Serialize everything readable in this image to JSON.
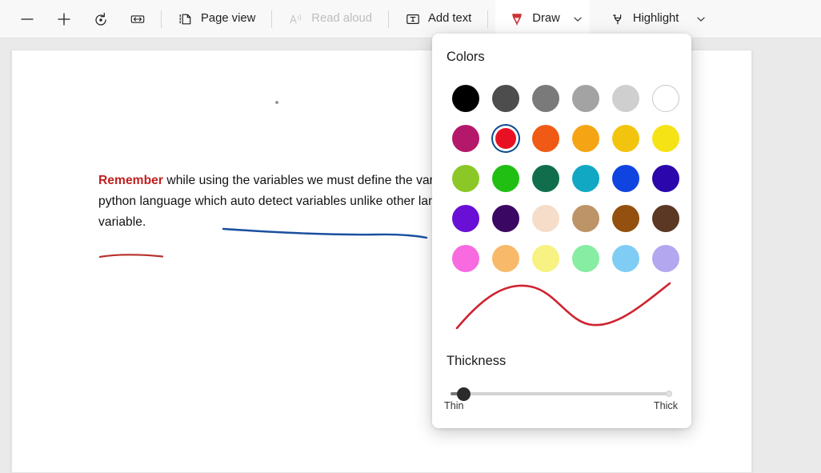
{
  "toolbar": {
    "items": [
      {
        "name": "zoom-out",
        "icon": "minus-icon",
        "label": "",
        "disabled": false
      },
      {
        "name": "zoom-in",
        "icon": "plus-icon",
        "label": "",
        "disabled": false
      },
      {
        "name": "rotate",
        "icon": "rotate-icon",
        "label": "",
        "disabled": false
      },
      {
        "name": "fit-width",
        "icon": "fit-width-icon",
        "label": "",
        "disabled": false
      },
      {
        "name": "page-view",
        "icon": "page-view-icon",
        "label": "Page view",
        "disabled": false
      },
      {
        "name": "read-aloud",
        "icon": "read-aloud-icon",
        "label": "Read aloud",
        "disabled": true
      },
      {
        "name": "add-text",
        "icon": "add-text-icon",
        "label": "Add text",
        "disabled": false
      }
    ],
    "draw": {
      "label": "Draw",
      "icon": "draw-pen-icon",
      "active": true,
      "accent_color": "#1565c0"
    },
    "highlight": {
      "label": "Highlight",
      "icon": "highlighter-icon",
      "active": false
    }
  },
  "document": {
    "paragraph_lead": "Remember",
    "paragraph_body": " while using the variables we must define the variable of integer type in above example. It is python language which auto detect variables unlike other languages which require to declare type of variable.",
    "ink_strokes": [
      {
        "name": "blue-underline-stroke",
        "color": "#1a4fa0"
      },
      {
        "name": "red-underline-stroke",
        "color": "#b7302c"
      }
    ],
    "ink_dot": {
      "name": "ink-dot",
      "color": "#9a9a9a"
    }
  },
  "colors_panel": {
    "title": "Colors",
    "selected_color": "#e81123",
    "selected_index": 7,
    "swatches": [
      {
        "name": "black",
        "hex": "#000000"
      },
      {
        "name": "dark-gray",
        "hex": "#4d4d4d"
      },
      {
        "name": "gray",
        "hex": "#7a7a7a"
      },
      {
        "name": "medium-gray",
        "hex": "#a3a3a3"
      },
      {
        "name": "light-gray",
        "hex": "#cfcfcf"
      },
      {
        "name": "white",
        "hex": "#ffffff"
      },
      {
        "name": "magenta",
        "hex": "#b4186a"
      },
      {
        "name": "red",
        "hex": "#e81123"
      },
      {
        "name": "orange-red",
        "hex": "#f05a14"
      },
      {
        "name": "orange",
        "hex": "#f5a414"
      },
      {
        "name": "gold",
        "hex": "#f2c40d"
      },
      {
        "name": "yellow",
        "hex": "#f5e315"
      },
      {
        "name": "yellow-green",
        "hex": "#8bc827"
      },
      {
        "name": "green",
        "hex": "#21bf14"
      },
      {
        "name": "dark-green",
        "hex": "#116e4c"
      },
      {
        "name": "teal",
        "hex": "#11a8c4"
      },
      {
        "name": "blue",
        "hex": "#1044e0"
      },
      {
        "name": "dark-blue",
        "hex": "#2b06ac"
      },
      {
        "name": "violet",
        "hex": "#6a0fd6"
      },
      {
        "name": "dark-purple",
        "hex": "#3a0863"
      },
      {
        "name": "peach",
        "hex": "#f6ddc9"
      },
      {
        "name": "tan",
        "hex": "#bd9467"
      },
      {
        "name": "brown",
        "hex": "#93500f"
      },
      {
        "name": "dark-brown",
        "hex": "#5a3824"
      },
      {
        "name": "pink",
        "hex": "#f86ae0"
      },
      {
        "name": "light-orange",
        "hex": "#f8b96b"
      },
      {
        "name": "light-yellow",
        "hex": "#f7f282"
      },
      {
        "name": "light-green",
        "hex": "#87eda3"
      },
      {
        "name": "light-blue",
        "hex": "#7fcdf5"
      },
      {
        "name": "lavender",
        "hex": "#b3a7f0"
      }
    ],
    "preview_stroke_color": "#cf2330",
    "thickness": {
      "title": "Thickness",
      "min_label": "Thin",
      "max_label": "Thick",
      "value_percent": 5
    }
  }
}
